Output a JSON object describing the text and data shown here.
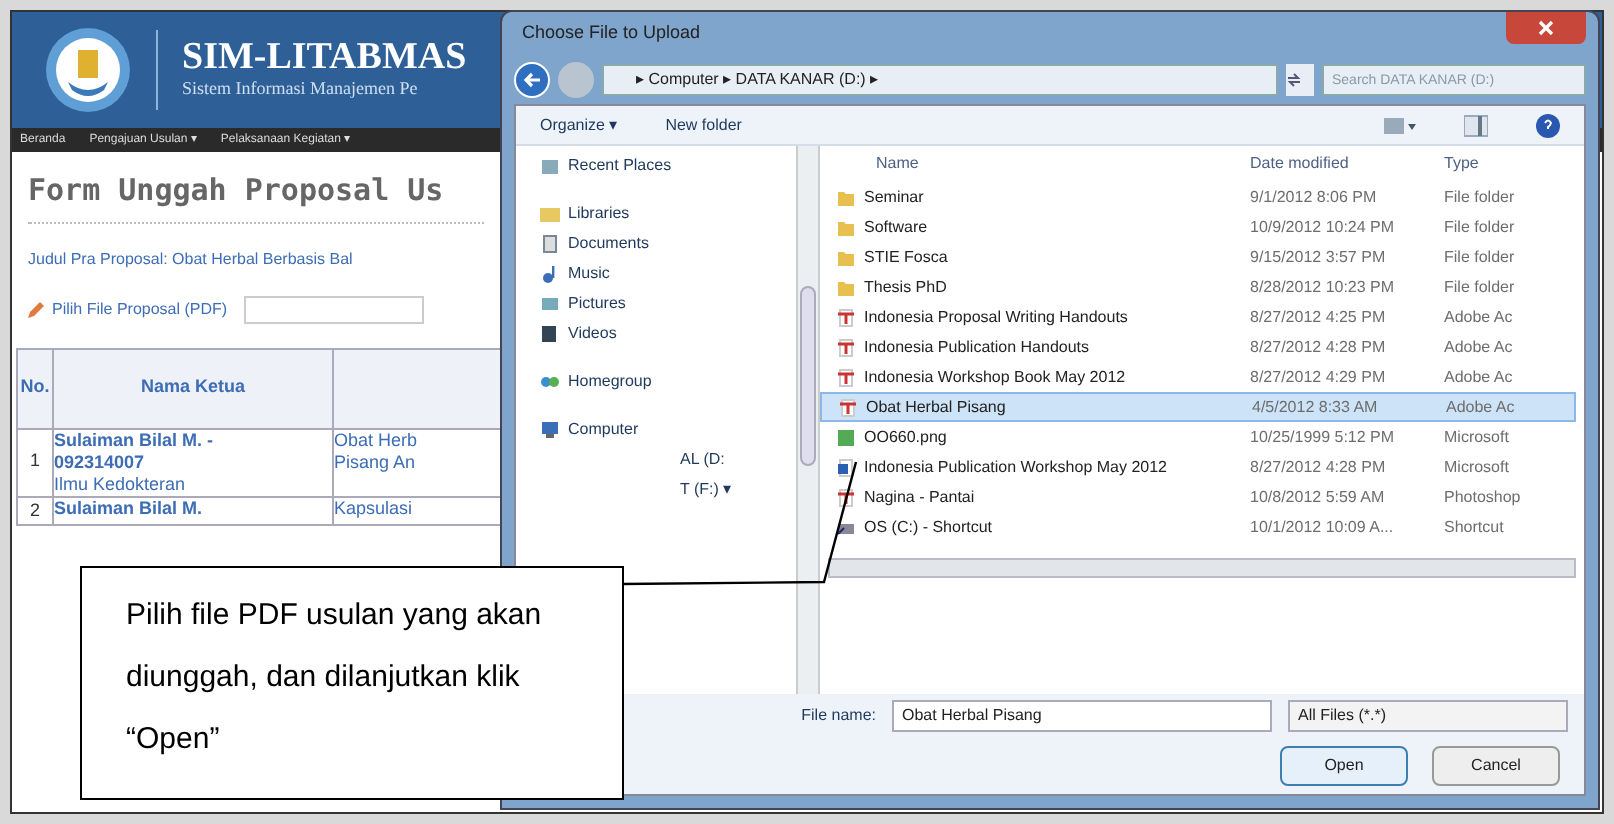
{
  "site": {
    "title": "SIM-LITABMAS",
    "subtitle": "Sistem Informasi Manajemen Pe",
    "nav": [
      "Beranda",
      "Pengajuan Usulan ▾",
      "Pelaksanaan Kegiatan ▾"
    ],
    "form_title": "Form Unggah Proposal Us",
    "proposal_title": "Judul Pra Proposal: Obat Herbal Berbasis Bal",
    "file_label": "Pilih File Proposal (PDF)",
    "table": {
      "columns": [
        "No.",
        "Nama Ketua"
      ],
      "rows": [
        {
          "no": "1",
          "lines": [
            "Sulaiman Bilal M. -",
            "092314007",
            "Ilmu Kedokteran"
          ],
          "title": [
            "Obat Herb",
            "Pisang An"
          ]
        },
        {
          "no": "2",
          "lines": [
            "Sulaiman Bilal M."
          ],
          "title": [
            "Kapsulasi"
          ]
        }
      ]
    }
  },
  "dialog": {
    "title": "Choose File to Upload",
    "path": "▸ Computer ▸ DATA KANAR (D:) ▸",
    "search": {
      "placeholder": "Search DATA KANAR (D:)"
    },
    "toolbar": [
      "Organize ▾",
      "New folder"
    ],
    "nav_pane": [
      {
        "label": "Recent Places",
        "kind": "recent"
      },
      {
        "label": "Libraries",
        "kind": "library"
      },
      {
        "label": "Documents",
        "kind": "documents"
      },
      {
        "label": "Music",
        "kind": "music"
      },
      {
        "label": "Pictures",
        "kind": "pictures"
      },
      {
        "label": "Videos",
        "kind": "videos"
      },
      {
        "label": "Homegroup",
        "kind": "homegroup"
      },
      {
        "label": "Computer",
        "kind": "computer"
      },
      {
        "label": "AL (D:",
        "kind": "drive"
      },
      {
        "label": "T (F:) ▾",
        "kind": "drive"
      }
    ],
    "columns": [
      "Name",
      "Date modified",
      "Type"
    ],
    "files": [
      {
        "name": "Seminar",
        "date": "9/1/2012 8:06 PM",
        "type": "File folder",
        "kind": "folder",
        "selected": false
      },
      {
        "name": "Software",
        "date": "10/9/2012 10:24 PM",
        "type": "File folder",
        "kind": "folder",
        "selected": false
      },
      {
        "name": "STIE Fosca",
        "date": "9/15/2012 3:57 PM",
        "type": "File folder",
        "kind": "folder",
        "selected": false
      },
      {
        "name": "Thesis PhD",
        "date": "8/28/2012 10:23 PM",
        "type": "File folder",
        "kind": "folder",
        "selected": false
      },
      {
        "name": "Indonesia Proposal Writing Handouts",
        "date": "8/27/2012 4:25 PM",
        "type": "Adobe Ac",
        "kind": "pdf",
        "selected": false
      },
      {
        "name": "Indonesia Publication Handouts",
        "date": "8/27/2012 4:28 PM",
        "type": "Adobe Ac",
        "kind": "pdf",
        "selected": false
      },
      {
        "name": "Indonesia Workshop Book May 2012",
        "date": "8/27/2012 4:29 PM",
        "type": "Adobe Ac",
        "kind": "pdf",
        "selected": false
      },
      {
        "name": "Obat Herbal Pisang",
        "date": "4/5/2012 8:33 AM",
        "type": "Adobe Ac",
        "kind": "pdf",
        "selected": true
      },
      {
        "name": "OO660.png",
        "date": "10/25/1999 5:12 PM",
        "type": "Microsoft",
        "kind": "image",
        "selected": false
      },
      {
        "name": "Indonesia Publication Workshop May 2012",
        "date": "8/27/2012 4:28 PM",
        "type": "Microsoft",
        "kind": "doc",
        "selected": false
      },
      {
        "name": "Nagina - Pantai",
        "date": "10/8/2012 5:59 AM",
        "type": "Photoshop",
        "kind": "pdf",
        "selected": false
      },
      {
        "name": "OS (C:) - Shortcut",
        "date": "10/1/2012 10:09 A...",
        "type": "Shortcut",
        "kind": "shortcut",
        "selected": false
      }
    ],
    "file_name_label": "File name:",
    "file_name": "Obat Herbal Pisang",
    "filter": "All Files (*.*)",
    "buttons": [
      "Open",
      "Cancel"
    ]
  },
  "callout": "Pilih file PDF usulan yang akan diunggah, dan dilanjutkan klik “Open”"
}
